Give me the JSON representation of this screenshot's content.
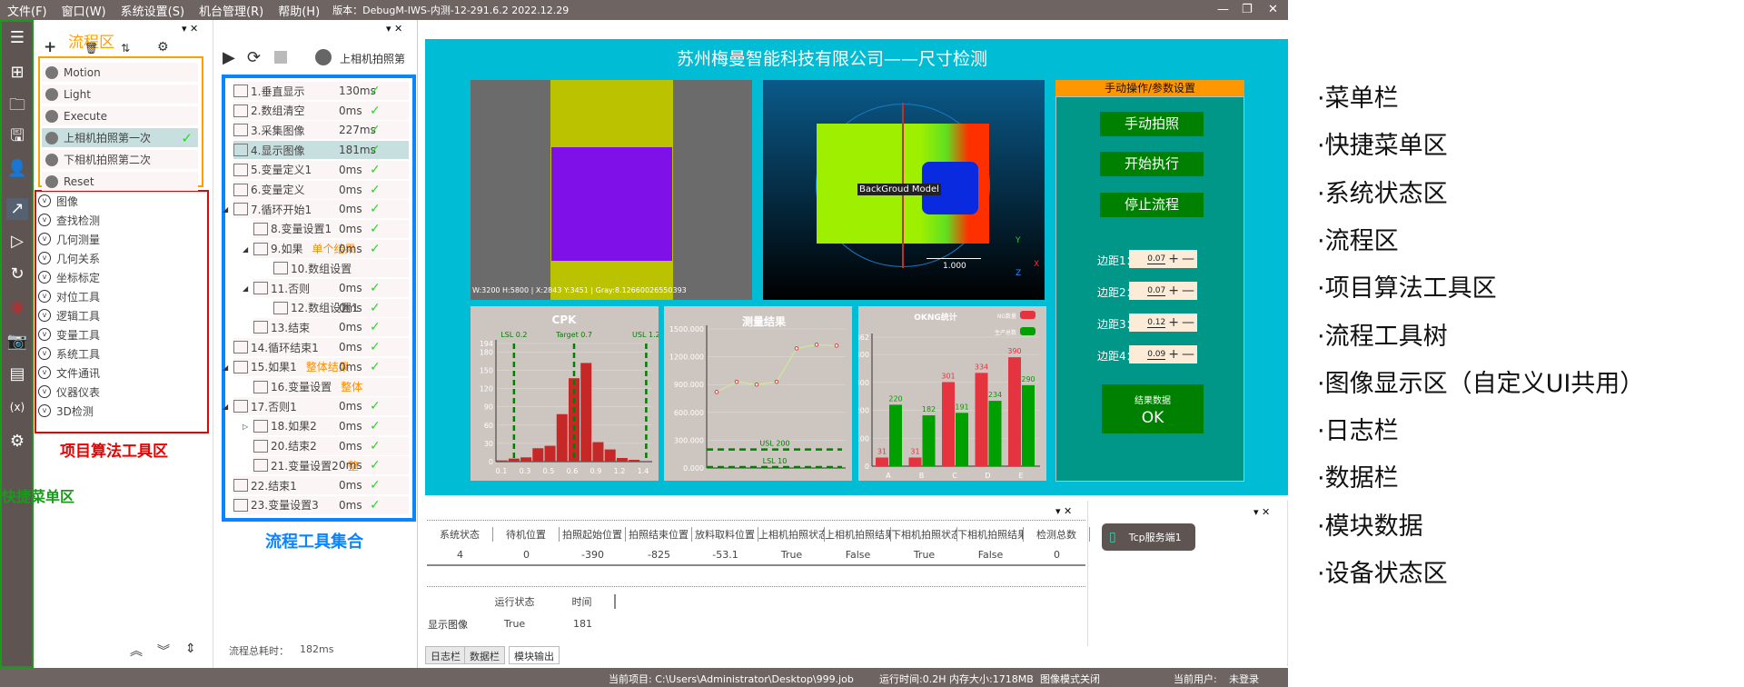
{
  "menubar": {
    "items": [
      "文件(F)",
      "窗口(W)",
      "系统设置(S)",
      "机台管理(R)",
      "帮助(H)"
    ],
    "version": "版本：DebugM-IWS-内测-12-291.6.2 2022.12.29"
  },
  "window_controls": [
    "—",
    "❐",
    "✕"
  ],
  "quick_toolbar": {
    "icons": [
      "list-icon",
      "new-file-icon",
      "open-folder-icon",
      "save-icon",
      "user-icon",
      "flow-edit-icon",
      "run-icon",
      "loop-run-icon",
      "stop-icon",
      "camera-icon",
      "device-icon",
      "variable-icon",
      "settings-window-icon"
    ]
  },
  "annotations": {
    "flow_area": "流程区",
    "tool_area": "项目算法工具区",
    "quick_menu": "快捷菜单区",
    "flow_tools": "流程工具集合"
  },
  "flow_panel": {
    "items": [
      {
        "label": "Motion",
        "icon": "flow-icon"
      },
      {
        "label": "Light",
        "icon": "flow-icon"
      },
      {
        "label": "Execute",
        "icon": "process-icon"
      },
      {
        "label": "上相机拍照第一次",
        "icon": "process-icon",
        "selected": true,
        "status": "✓"
      },
      {
        "label": "下相机拍照第二次",
        "icon": "process-icon"
      },
      {
        "label": "Reset",
        "icon": "process-icon"
      }
    ]
  },
  "tool_categories": [
    "图像",
    "查找检测",
    "几何测量",
    "几何关系",
    "坐标标定",
    "对位工具",
    "逻辑工具",
    "变量工具",
    "系统工具",
    "文件通讯",
    "仪器仪表",
    "3D检测"
  ],
  "tool_tree": {
    "current_flow": "上相机拍照第",
    "items": [
      {
        "label": "1.垂直显示",
        "time": "130ms",
        "ok": "✓",
        "level": 0
      },
      {
        "label": "2.数组清空",
        "time": "0ms",
        "ok": "✓",
        "level": 0
      },
      {
        "label": "3.采集图像",
        "time": "227ms",
        "ok": "✓",
        "level": 0
      },
      {
        "label": "4.显示图像",
        "time": "181ms",
        "ok": "✓",
        "level": 0,
        "selected": true
      },
      {
        "label": "5.变量定义1",
        "time": "0ms",
        "ok": "✓",
        "level": 0
      },
      {
        "label": "6.变量定义",
        "time": "0ms",
        "ok": "✓",
        "level": 0
      },
      {
        "label": "7.循环开始1",
        "time": "0ms",
        "ok": "✓",
        "level": 0,
        "expanded": true
      },
      {
        "label": "8.变量设置1",
        "time": "0ms",
        "ok": "✓",
        "level": 1
      },
      {
        "label": "9.如果",
        "time": "0ms",
        "ok": "✓",
        "level": 1,
        "expanded": true,
        "note": "单个结果"
      },
      {
        "label": "10.数组设置",
        "time": "",
        "ok": "",
        "level": 2
      },
      {
        "label": "11.否则",
        "time": "0ms",
        "ok": "✓",
        "level": 1,
        "expanded": true
      },
      {
        "label": "12.数组设置1",
        "time": "0ms",
        "ok": "✓",
        "level": 2
      },
      {
        "label": "13.结束",
        "time": "0ms",
        "ok": "✓",
        "level": 1
      },
      {
        "label": "14.循环结束1",
        "time": "0ms",
        "ok": "✓",
        "level": 0
      },
      {
        "label": "15.如果1",
        "time": "0ms",
        "ok": "✓",
        "level": 0,
        "expanded": true,
        "note": "整体结果"
      },
      {
        "label": "16.变量设置",
        "time": "",
        "ok": "",
        "level": 1,
        "note": "整体"
      },
      {
        "label": "17.否则1",
        "time": "0ms",
        "ok": "✓",
        "level": 0,
        "expanded": true
      },
      {
        "label": "18.如果2",
        "time": "0ms",
        "ok": "✓",
        "level": 1,
        "collapsed": true
      },
      {
        "label": "20.结束2",
        "time": "0ms",
        "ok": "✓",
        "level": 1
      },
      {
        "label": "21.变量设置2",
        "time": "0ms",
        "ok": "✓",
        "level": 1,
        "note": "整"
      },
      {
        "label": "22.结束1",
        "time": "0ms",
        "ok": "✓",
        "level": 0
      },
      {
        "label": "23.变量设置3",
        "time": "0ms",
        "ok": "✓",
        "level": 0
      }
    ],
    "total_label": "流程总耗时：",
    "total_value": "182ms"
  },
  "main": {
    "title": "苏州梅曼智能科技有限公司——尺寸检测",
    "image_info": "W:3200 H:5800 | X:2843 Y:3451 | Gray:8.12660026550393",
    "model_label": "BackGroud Model",
    "scale_label": "1.000",
    "axis_labels": [
      "Y",
      "X",
      "Z"
    ],
    "panel": {
      "header": "手动操作/参数设置",
      "buttons": [
        "手动拍照",
        "开始执行",
        "停止流程"
      ],
      "params": [
        {
          "label": "边距1：",
          "value": "0.07"
        },
        {
          "label": "边距2：",
          "value": "0.07"
        },
        {
          "label": "边距3：",
          "value": "0.12"
        },
        {
          "label": "边距4：",
          "value": "0.09"
        }
      ],
      "plus": "+",
      "minus": "—",
      "result_label": "结果数据",
      "result_value": "OK"
    },
    "colors": {
      "background": "#00bcd4",
      "panel": "#009688",
      "button": "#008000",
      "header": "#ff9800"
    }
  },
  "chart_data": [
    {
      "type": "bar",
      "title": "CPK",
      "categories": [
        "0.1",
        "0.2",
        "0.3",
        "0.4",
        "0.5",
        "0.6",
        "0.7",
        "0.8",
        "0.9",
        "1.0",
        "1.1",
        "1.2"
      ],
      "values": [
        2,
        5,
        7,
        22,
        26,
        78,
        137,
        162,
        32,
        20,
        6,
        3
      ],
      "xticks": [
        "0.1",
        "0.3",
        "0.5",
        "0.6",
        "0.9",
        "1.2",
        "1.4"
      ],
      "yticks": [
        "0",
        "30",
        "60",
        "90",
        "120",
        "150",
        "180",
        "194"
      ],
      "ylim": [
        0,
        194
      ],
      "limits": [
        {
          "label": "LSL 0.2",
          "x": 0.2
        },
        {
          "label": "Target 0.7",
          "x": 0.7
        },
        {
          "label": "USL 1.2",
          "x": 1.3
        }
      ],
      "bar_color": "#c62828",
      "limit_color": "#008000"
    },
    {
      "type": "line",
      "title": "测量结果",
      "values": [
        820,
        930,
        900,
        930,
        1290,
        1330,
        1320
      ],
      "yticks": [
        "0.000",
        "300.000",
        "600.000",
        "900.000",
        "1200.000",
        "1500.000"
      ],
      "ylim": [
        0,
        1500
      ],
      "limits": [
        {
          "label": "USL 200",
          "y": 200
        },
        {
          "label": "LSL 10",
          "y": 10
        }
      ],
      "line_color": "#cfe3a0",
      "point_color": "#d04040"
    },
    {
      "type": "bar",
      "title": "OKNG统计",
      "categories": [
        "A",
        "B",
        "C",
        "D",
        "E"
      ],
      "series": [
        {
          "name": "NG数量",
          "values": [
            31,
            31,
            301,
            334,
            390
          ],
          "color": "#e53340"
        },
        {
          "name": "生产总数",
          "values": [
            220,
            182,
            191,
            234,
            290
          ],
          "color": "#00a000"
        }
      ],
      "yticks": [
        "0",
        "100",
        "200",
        "300",
        "400",
        "462"
      ],
      "ylim": [
        0,
        462
      ],
      "legend": "top-right"
    }
  ],
  "data_bar": {
    "headers": [
      "系统状态",
      "待机位置",
      "拍照起始位置",
      "拍照结束位置",
      "放料取料位置",
      "上相机拍照状态",
      "上相机拍照结果",
      "下相机拍照状态",
      "下相机拍照结果",
      "检测总数"
    ],
    "values": [
      "4",
      "0",
      "-390",
      "-825",
      "-53.1",
      "True",
      "False",
      "True",
      "False",
      "0"
    ],
    "module_headers": [
      "运行状态",
      "时间"
    ],
    "module_row": {
      "name": "显示图像",
      "status": "True",
      "time": "181"
    },
    "tabs": [
      "日志栏",
      "数据栏",
      "模块输出"
    ]
  },
  "device_panel": {
    "devices": [
      {
        "label": "Tcp服务端1",
        "icon": "tcp-server-icon"
      }
    ]
  },
  "statusbar": {
    "project": "当前项目: C:\\Users\\Administrator\\Desktop\\999.job",
    "runtime": "运行时间:0.2H",
    "memory": "内存大小:1718MB",
    "image_mode": "图像模式关闭",
    "user_label": "当前用户:",
    "user_value": "未登录"
  },
  "legend_labels": [
    "·菜单栏",
    "·快捷菜单区",
    "·系统状态区",
    "·流程区",
    "·项目算法工具区",
    "·流程工具树",
    "·图像显示区（自定义UI共用）",
    "·日志栏",
    "·数据栏",
    "·模块数据",
    "·设备状态区"
  ]
}
